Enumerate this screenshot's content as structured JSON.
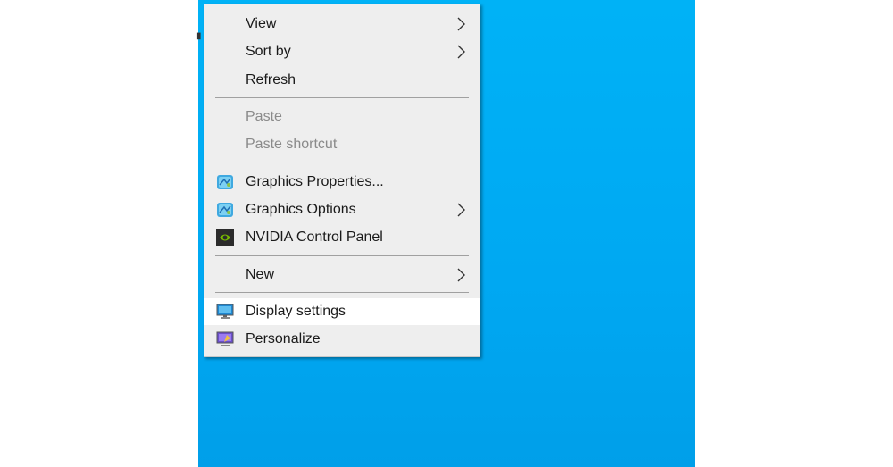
{
  "menu": {
    "items": [
      {
        "label": "View",
        "submenu": true,
        "disabled": false
      },
      {
        "label": "Sort by",
        "submenu": true,
        "disabled": false
      },
      {
        "label": "Refresh",
        "submenu": false,
        "disabled": false
      },
      {
        "label": "Paste",
        "submenu": false,
        "disabled": true
      },
      {
        "label": "Paste shortcut",
        "submenu": false,
        "disabled": true
      },
      {
        "label": "Graphics Properties...",
        "submenu": false,
        "disabled": false,
        "icon": "intel-graphics-icon"
      },
      {
        "label": "Graphics Options",
        "submenu": true,
        "disabled": false,
        "icon": "intel-graphics-icon"
      },
      {
        "label": "NVIDIA Control Panel",
        "submenu": false,
        "disabled": false,
        "icon": "nvidia-icon"
      },
      {
        "label": "New",
        "submenu": true,
        "disabled": false
      },
      {
        "label": "Display settings",
        "submenu": false,
        "disabled": false,
        "icon": "display-icon",
        "hovered": true
      },
      {
        "label": "Personalize",
        "submenu": false,
        "disabled": false,
        "icon": "personalize-icon"
      }
    ]
  },
  "colors": {
    "desktop": "#00a8f2",
    "menu_bg": "#eeeeee",
    "hover_bg": "#ffffff",
    "disabled_text": "#8a8a8a"
  }
}
